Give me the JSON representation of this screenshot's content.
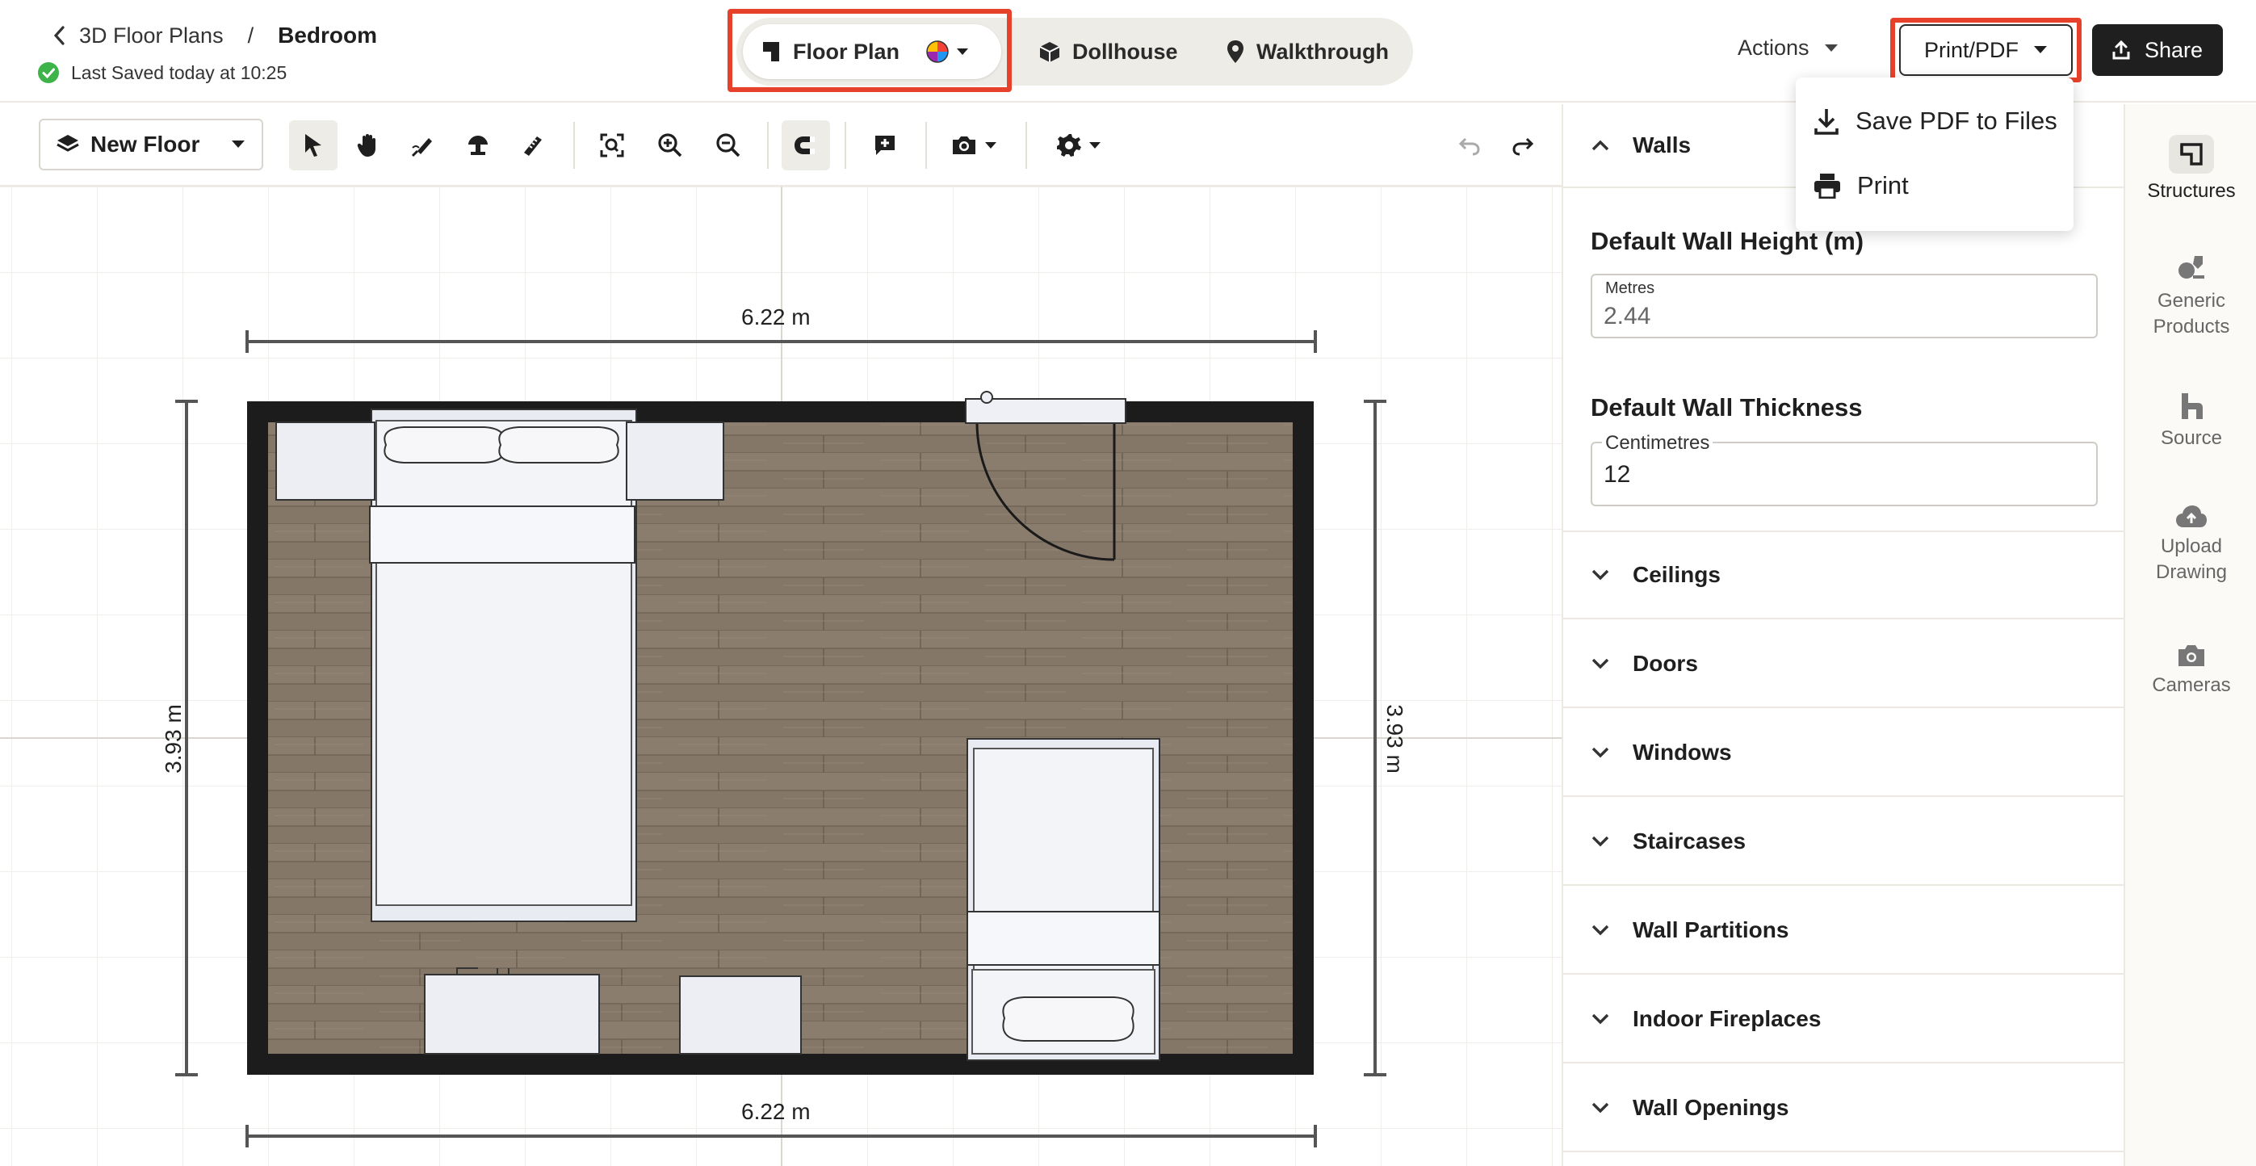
{
  "breadcrumb": {
    "parent": "3D Floor Plans",
    "separator": "/",
    "current": "Bedroom"
  },
  "status": {
    "saved_text": "Last Saved today at 10:25"
  },
  "view_tabs": [
    {
      "label": "Floor Plan",
      "active": true
    },
    {
      "label": "Dollhouse",
      "active": false
    },
    {
      "label": "Walkthrough",
      "active": false
    }
  ],
  "header": {
    "actions_label": "Actions",
    "print_label": "Print/PDF",
    "share_label": "Share"
  },
  "print_menu": {
    "items": [
      {
        "label": "Save PDF to Files",
        "icon": "download-icon"
      },
      {
        "label": "Print",
        "icon": "printer-icon"
      }
    ]
  },
  "toolbar": {
    "floor_label": "New Floor"
  },
  "plan": {
    "top_width": "6.22 m",
    "bottom_width": "6.22 m",
    "left_height": "3.93 m",
    "right_height": "3.93 m"
  },
  "panel": {
    "walls_title": "Walls",
    "wall_height_title": "Default Wall Height (m)",
    "wall_height_unit": "Metres",
    "wall_height_value": "2.44",
    "wall_thickness_title": "Default Wall Thickness",
    "wall_thickness_unit": "Centimetres",
    "wall_thickness_value": "12",
    "sections": [
      "Ceilings",
      "Doors",
      "Windows",
      "Staircases",
      "Wall Partitions",
      "Indoor Fireplaces",
      "Wall Openings"
    ]
  },
  "sidebar": {
    "items": [
      {
        "label1": "Structures",
        "label2": "",
        "icon": "structures-icon"
      },
      {
        "label1": "Generic",
        "label2": "Products",
        "icon": "products-icon"
      },
      {
        "label1": "Source",
        "label2": "",
        "icon": "source-icon"
      },
      {
        "label1": "Upload",
        "label2": "Drawing",
        "icon": "upload-icon"
      },
      {
        "label1": "Cameras",
        "label2": "",
        "icon": "camera-icon"
      }
    ]
  },
  "colors": {
    "accent_red": "#e6412b",
    "saved_green": "#3db34a",
    "floor_wood": "#857767",
    "wall": "#1c1c1c"
  }
}
